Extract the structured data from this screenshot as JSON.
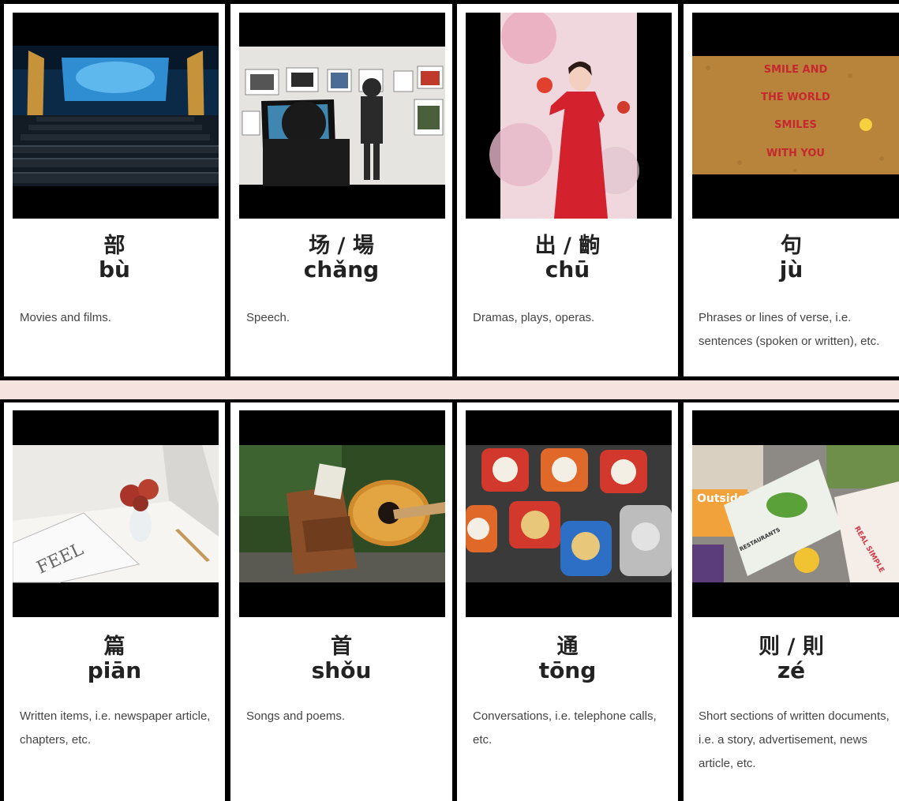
{
  "cards": [
    {
      "hanzi": "部",
      "pinyin": "bù",
      "description": "Movies and films.",
      "image": "movie-theater"
    },
    {
      "hanzi": "场 / 場",
      "pinyin": "chǎng",
      "description": "Speech.",
      "image": "speaker-at-gallery"
    },
    {
      "hanzi": "出 / 齣",
      "pinyin": "chū",
      "description": "Dramas, plays, operas.",
      "image": "woman-in-red-dress"
    },
    {
      "hanzi": "句",
      "pinyin": "jù",
      "description": "Phrases or lines of verse, i.e. sentences (spoken or written), etc.",
      "image": "scrabble-tiles",
      "image_text": [
        "SMILE AND",
        "THE WORLD",
        "SMILES",
        "WITH YOU"
      ]
    },
    {
      "hanzi": "篇",
      "pinyin": "piān",
      "description": "Written items, i.e. newspaper article, chapters, etc.",
      "image": "magazine-and-flowers",
      "image_text": [
        "FEEL"
      ]
    },
    {
      "hanzi": "首",
      "pinyin": "shǒu",
      "description": "Songs and poems.",
      "image": "guitar-and-backpack"
    },
    {
      "hanzi": "通",
      "pinyin": "tōng",
      "description": "Conversations, i.e. telephone calls, etc.",
      "image": "rotary-telephones"
    },
    {
      "hanzi": "则 / 則",
      "pinyin": "zé",
      "description": "Short sections of written documents, i.e. a story, advertisement, news article, etc.",
      "image": "pile-of-magazines",
      "image_text": [
        "Outside",
        "REAL SIMPLE",
        "RESTAURANTS"
      ]
    }
  ],
  "colors": {
    "band": "#f4e3de",
    "card": "#ffffff",
    "text": "#222222",
    "frame": "#000000"
  }
}
